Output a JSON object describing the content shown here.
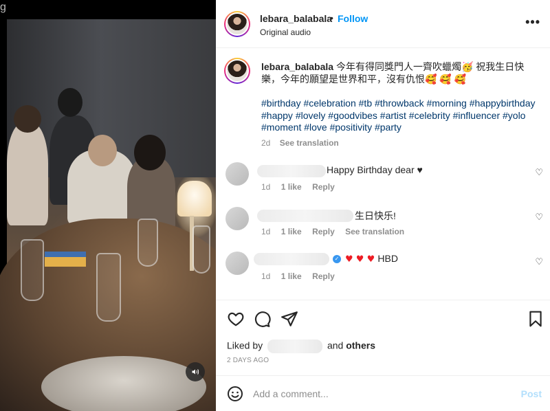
{
  "header": {
    "username": "lebara_balabala",
    "dot": "•",
    "follow": "Follow",
    "audio": "Original audio",
    "more": "•••"
  },
  "caption": {
    "username": "lebara_balabala",
    "text": "今年有得同獎門人一齊吹蠟燭🥳 祝我生日快樂，今年的願望是世界和平，沒有仇恨🥰 🥰 🥰",
    "hashtags": "#birthday #celebration #tb #throwback #morning #happybirthday #happy #lovely #goodvibes #artist #celebrity #influencer #yolo #moment #love #positivity #party",
    "time": "2d",
    "see_translation": "See translation"
  },
  "comments": [
    {
      "text": "Happy Birthday dear ♥",
      "time": "1d",
      "likes": "1 like",
      "reply": "Reply",
      "translation": ""
    },
    {
      "text": "生日快乐!",
      "time": "1d",
      "likes": "1 like",
      "reply": "Reply",
      "translation": "See translation"
    },
    {
      "text": "HBD",
      "time": "1d",
      "likes": "1 like",
      "reply": "Reply",
      "translation": ""
    }
  ],
  "liked": {
    "prefix": "Liked by",
    "and": "and",
    "others": "others"
  },
  "date": "2 DAYS AGO",
  "add_comment": {
    "placeholder": "Add a comment...",
    "post": "Post"
  },
  "media": {
    "mute_icon": "speaker-icon",
    "edge_text": "g"
  },
  "colors": {
    "link": "#0095f6",
    "hashtag": "#00376b",
    "meta": "#8e8e8e",
    "post_disabled": "#b2dffc"
  }
}
